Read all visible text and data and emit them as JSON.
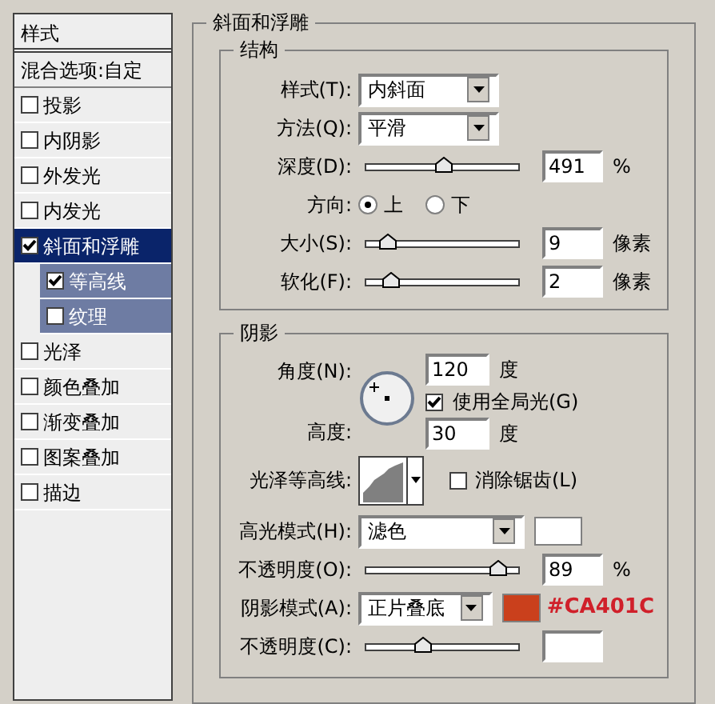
{
  "sidebar": {
    "title": "样式",
    "blend_options": "混合选项:自定",
    "items": [
      {
        "label": "投影",
        "checked": false,
        "selected": false
      },
      {
        "label": "内阴影",
        "checked": false,
        "selected": false
      },
      {
        "label": "外发光",
        "checked": false,
        "selected": false
      },
      {
        "label": "内发光",
        "checked": false,
        "selected": false
      },
      {
        "label": "斜面和浮雕",
        "checked": true,
        "selected": true,
        "children": [
          {
            "label": "等高线",
            "checked": true
          },
          {
            "label": "纹理",
            "checked": false
          }
        ]
      },
      {
        "label": "光泽",
        "checked": false,
        "selected": false
      },
      {
        "label": "颜色叠加",
        "checked": false,
        "selected": false
      },
      {
        "label": "渐变叠加",
        "checked": false,
        "selected": false
      },
      {
        "label": "图案叠加",
        "checked": false,
        "selected": false
      },
      {
        "label": "描边",
        "checked": false,
        "selected": false
      }
    ]
  },
  "panel_title": "斜面和浮雕",
  "structure": {
    "title": "结构",
    "rows": [
      {
        "kind": "dropdown",
        "label": "样式(T):",
        "value": "内斜面"
      },
      {
        "kind": "dropdown",
        "label": "方法(Q):",
        "value": "平滑"
      },
      {
        "kind": "slider",
        "label": "深度(D):",
        "level": 0.5,
        "value": "491",
        "unit": "%"
      },
      {
        "kind": "radio",
        "label": "方向:",
        "options": [
          {
            "label": "上",
            "selected": true
          },
          {
            "label": "下",
            "selected": false
          }
        ]
      },
      {
        "kind": "slider",
        "label": "大小(S):",
        "level": 0.09,
        "value": "9",
        "unit": "像素"
      },
      {
        "kind": "slider",
        "label": "软化(F):",
        "level": 0.12,
        "value": "2",
        "unit": "像素"
      }
    ]
  },
  "shading": {
    "title": "阴影",
    "angle": {
      "label": "角度(N):",
      "value": "120",
      "unit": "度"
    },
    "global_light": {
      "label": "使用全局光(G)",
      "checked": true
    },
    "altitude": {
      "label": "高度:",
      "value": "30",
      "unit": "度"
    },
    "gloss_contour": {
      "label": "光泽等高线:",
      "anti_alias": {
        "label": "消除锯齿(L)",
        "checked": false
      }
    },
    "rows": [
      {
        "kind": "mode",
        "label": "高光模式(H):",
        "value": "滤色",
        "color": "#ffffff"
      },
      {
        "kind": "slider",
        "label": "不透明度(O):",
        "level": 0.89,
        "value": "89",
        "unit": "%"
      },
      {
        "kind": "mode",
        "label": "阴影模式(A):",
        "value": "正片叠底",
        "color": "#ca401c",
        "note": "#CA401C"
      },
      {
        "kind": "slider",
        "label": "不透明度(C):",
        "level": 0.35
      }
    ]
  }
}
